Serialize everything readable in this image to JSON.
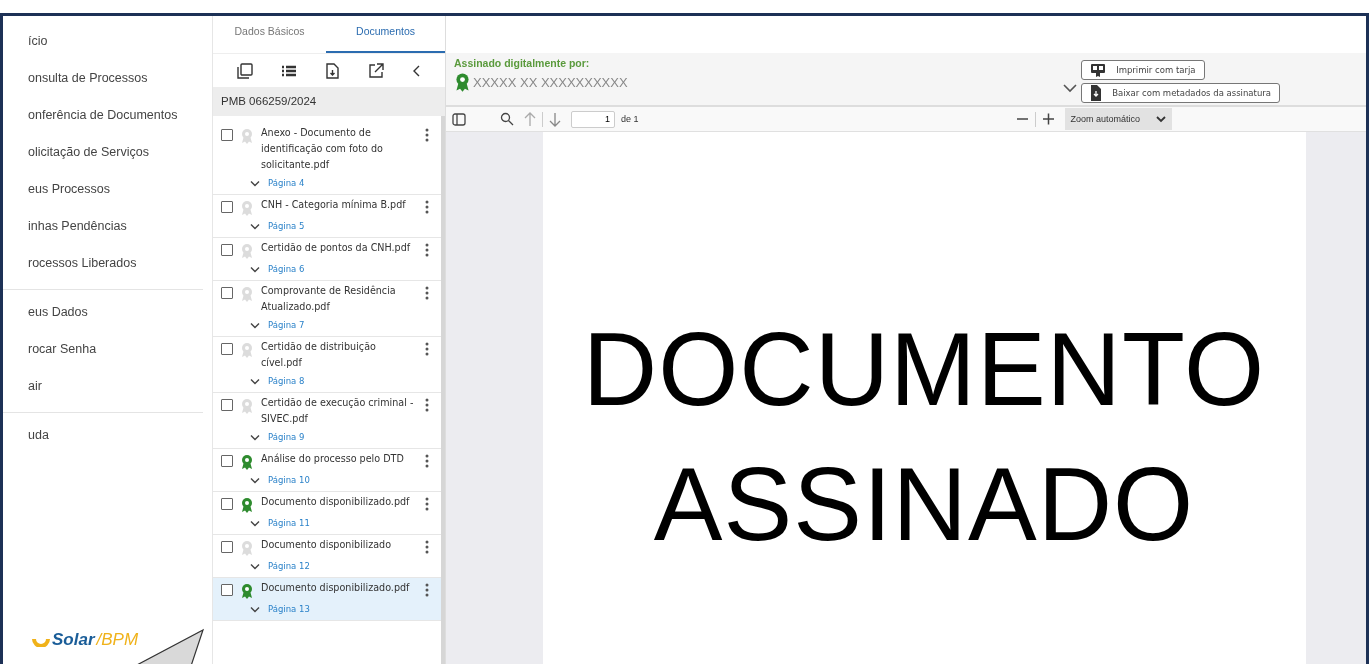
{
  "nav": {
    "groups": [
      [
        "ício",
        "onsulta de Processos",
        "onferência de Documentos",
        "olicitação de Serviços",
        "eus Processos",
        "inhas Pendências",
        "rocessos Liberados"
      ],
      [
        "eus Dados",
        "rocar Senha",
        "air"
      ],
      [
        "uda"
      ]
    ],
    "logo": {
      "brand": "Solar",
      "suffix": "/BPM"
    }
  },
  "tabs": [
    {
      "label": "Dados Básicos",
      "selected": false
    },
    {
      "label": "Documentos",
      "selected": true
    }
  ],
  "doc_panel": {
    "process_number": "PMB 066259/2024",
    "documents": [
      {
        "title": "Anexo - Documento de identificação com foto do solicitante.pdf",
        "signed": false,
        "page": "Página 4",
        "selected": false,
        "checked": false
      },
      {
        "title": "CNH - Categoria mínima B.pdf",
        "signed": false,
        "page": "Página 5",
        "selected": false,
        "checked": false
      },
      {
        "title": "Certidão de pontos da CNH.pdf",
        "signed": false,
        "page": "Página 6",
        "selected": false,
        "checked": false
      },
      {
        "title": "Comprovante de Residência Atualizado.pdf",
        "signed": false,
        "page": "Página 7",
        "selected": false,
        "checked": false
      },
      {
        "title": "Certidão de distribuição cível.pdf",
        "signed": false,
        "page": "Página 8",
        "selected": false,
        "checked": false
      },
      {
        "title": "Certidão de execução criminal - SIVEC.pdf",
        "signed": false,
        "page": "Página 9",
        "selected": false,
        "checked": false
      },
      {
        "title": "Análise do processo pelo DTD",
        "signed": true,
        "page": "Página 10",
        "selected": false,
        "checked": false
      },
      {
        "title": "Documento disponibilizado.pdf",
        "signed": true,
        "page": "Página 11",
        "selected": false,
        "checked": false
      },
      {
        "title": "Documento disponibilizado",
        "signed": false,
        "page": "Página 12",
        "selected": false,
        "checked": false
      },
      {
        "title": "Documento disponibilizado.pdf",
        "signed": true,
        "page": "Página 13",
        "selected": true,
        "checked": false
      }
    ]
  },
  "viewer": {
    "signature": {
      "label": "Assinado digitalmente por:",
      "signer": "XXXXX XX XXXXXXXXXX"
    },
    "buttons": [
      {
        "kind": "print",
        "label": "Imprimir com tarja"
      },
      {
        "kind": "download",
        "label": "Baixar com metadados da assinatura"
      }
    ],
    "toolbar": {
      "page": "1",
      "total": "de 1",
      "zoom": "Zoom automático"
    },
    "document_lines": [
      "DOCUMENTO",
      "ASSINADO"
    ]
  }
}
